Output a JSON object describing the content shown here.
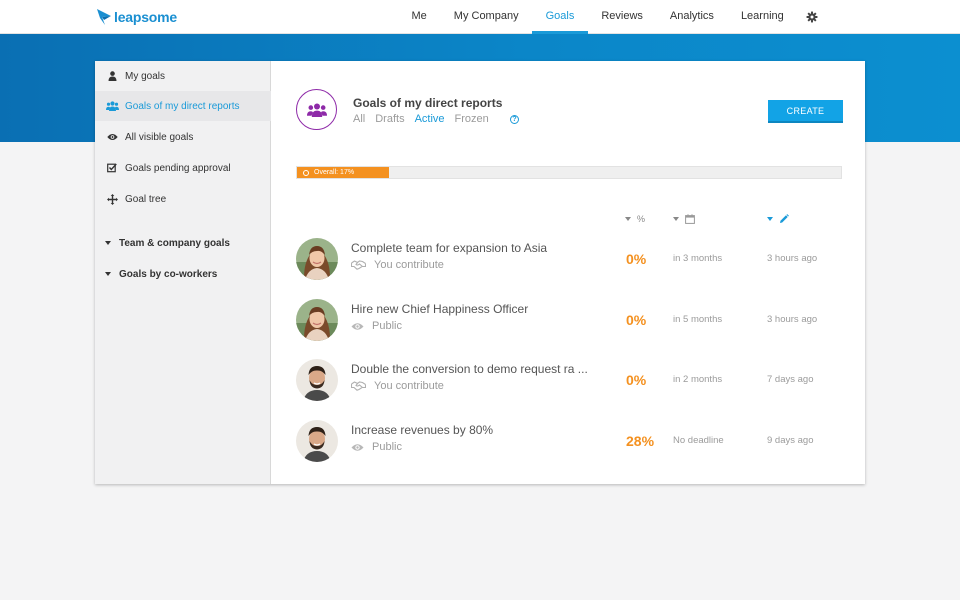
{
  "logo": {
    "text": "leapsome"
  },
  "nav": {
    "items": [
      "Me",
      "My Company",
      "Goals",
      "Reviews",
      "Analytics",
      "Learning"
    ],
    "active": "Goals",
    "settings_icon": "gear-icon"
  },
  "sidebar": {
    "items": [
      {
        "label": "My goals",
        "icon": "person-icon"
      },
      {
        "label": "Goals of my direct reports",
        "icon": "group-icon",
        "active": true
      },
      {
        "label": "All visible goals",
        "icon": "eye-icon"
      },
      {
        "label": "Goals pending approval",
        "icon": "checkbox-icon"
      },
      {
        "label": "Goal tree",
        "icon": "move-icon"
      }
    ],
    "groups": [
      {
        "label": "Team & company goals"
      },
      {
        "label": "Goals by co-workers"
      }
    ]
  },
  "header": {
    "title": "Goals of my direct reports",
    "filters": [
      "All",
      "Drafts",
      "Active",
      "Frozen"
    ],
    "active_filter": "Active",
    "help": "?",
    "create_label": "CREATE"
  },
  "overall": {
    "label": "Overall: 17%",
    "progress": 0.17
  },
  "columns": {
    "percent": "%"
  },
  "goals": [
    {
      "title": "Complete team for expansion to Asia",
      "visibility": "You contribute",
      "visibility_icon": "handshake-icon",
      "percent": "0%",
      "due": "in 3 months",
      "updated": "3 hours ago",
      "avatar": "woman"
    },
    {
      "title": "Hire new Chief Happiness Officer",
      "visibility": "Public",
      "visibility_icon": "eye-icon",
      "percent": "0%",
      "due": "in 5 months",
      "updated": "3 hours ago",
      "avatar": "woman"
    },
    {
      "title": "Double the conversion to demo request ra ...",
      "visibility": "You contribute",
      "visibility_icon": "handshake-icon",
      "percent": "0%",
      "due": "in 2 months",
      "updated": "7 days ago",
      "avatar": "man"
    },
    {
      "title": "Increase revenues by 80%",
      "visibility": "Public",
      "visibility_icon": "eye-icon",
      "percent": "28%",
      "due": "No deadline",
      "updated": "9 days ago",
      "avatar": "man"
    }
  ],
  "colors": {
    "accent": "#1a9ad8",
    "orange": "#f49120",
    "purple": "#8e2aa8"
  }
}
